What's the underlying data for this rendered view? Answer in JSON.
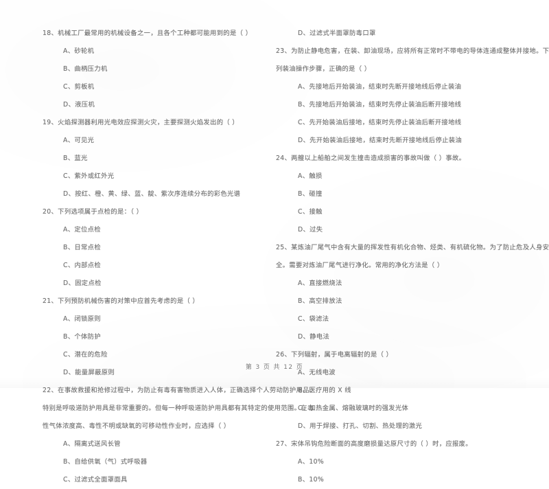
{
  "document": {
    "type": "scanned-exam-paper",
    "language": "zh-CN",
    "ink_color": "#6f6f6f",
    "paper_color": "#ffffff"
  },
  "footer": {
    "page_label": "第 3 页 共 12 页"
  },
  "columns": {
    "left": {
      "questions": [
        {
          "number": "18",
          "stem_lines": [
            "18、机械工厂最常用的机械设备之一，且各个工种都可能用到的是（      ）"
          ],
          "options": [
            "A、砂轮机",
            "B、曲柄压力机",
            "C、剪板机",
            "D、液压机"
          ]
        },
        {
          "number": "19",
          "stem_lines": [
            "19、火焰探测器利用光电效应探测火灾，主要探测火焰发出的（      ）"
          ],
          "options": [
            "A、可见光",
            "B、蓝光",
            "C、紫外或红外光",
            "D、按红、橙、黄、绿、蓝、靛、紫次序连续分布的彩色光谱"
          ]
        },
        {
          "number": "20",
          "stem_lines": [
            "20、下列选项属于点检的是：（      ）"
          ],
          "options": [
            "A、定位点检",
            "B、日常点检",
            "C、内部点检",
            "D、固定点检"
          ]
        },
        {
          "number": "21",
          "stem_lines": [
            "21、下列预防机械伤害的对策中应首先考虑的是（      ）"
          ],
          "options": [
            "A、闭锁原则",
            "B、个体防护",
            "C、潜在的危险",
            "D、能量屏蔽原则"
          ]
        },
        {
          "number": "22",
          "stem_lines": [
            "22、在事故救援和抢修过程中，为防止有毒有害物质进入人体，正确选择个人劳动防护用品。",
            "特别是呼吸道防护用具是非常重要的。但每一种呼吸道防护用具都有其特定的使用范围。在毒",
            "性气体浓度高、毒性不明或缺氧的可移动性作业时，应选择（      ）"
          ],
          "options": [
            "A、隔离式送风长管",
            "B、自给供氧（气）式呼吸器",
            "C、过滤式全面罩面具"
          ]
        }
      ]
    },
    "right": {
      "questions": [
        {
          "number": "22-cont",
          "stem_lines": [],
          "options": [
            "D、过滤式半面罩防毒口罩"
          ]
        },
        {
          "number": "23",
          "stem_lines": [
            "23、为防止静电危害，在装、卸油现场，应将所有正常时不带电的导体连通成整体并接地。下",
            "列装油操作步骤，正确的是（      ）"
          ],
          "options": [
            "A、先接地后开始装油，结束时先断开接地线后停止装油",
            "B、先接地后开始装油，结束时先停止装油后断开接地线",
            "C、先开始装油后接地，结束时先停止装油后断开接地线",
            "D、先开始装油后接地，结束时先断开接地线后停止装油"
          ]
        },
        {
          "number": "24",
          "stem_lines": [
            "24、两艘以上船舶之间发生撞击造成损害的事故叫做（      ）事故。"
          ],
          "options": [
            "A、触损",
            "B、碰撞",
            "C、接触",
            "D、过失"
          ]
        },
        {
          "number": "25",
          "stem_lines": [
            "25、某炼油厂尾气中含有大量的挥发性有机化合物、烃类、有机硫化物。为了防止危及人身安",
            "全。需要对炼油厂尾气进行净化。常用的净化方法是（      ）"
          ],
          "options": [
            "A、直接燃烧法",
            "B、高空排放法",
            "C、袋滤法",
            "D、静电法"
          ]
        },
        {
          "number": "26",
          "stem_lines": [
            "26、下列辐射，属于电离辐射的是（      ）"
          ],
          "options": [
            "A、无线电波",
            "B、医疗用的 X 线",
            "C、加热金属、熔融玻璃时的强发光体",
            "D、用于焊接、打孔、切割、热处理的激光"
          ]
        },
        {
          "number": "27",
          "stem_lines": [
            "27、宋体吊钩危险断面的高度磨损量达原尺寸的（      ）时，应报废。"
          ],
          "options": [
            "A、10%",
            "B、10%"
          ]
        }
      ]
    }
  }
}
